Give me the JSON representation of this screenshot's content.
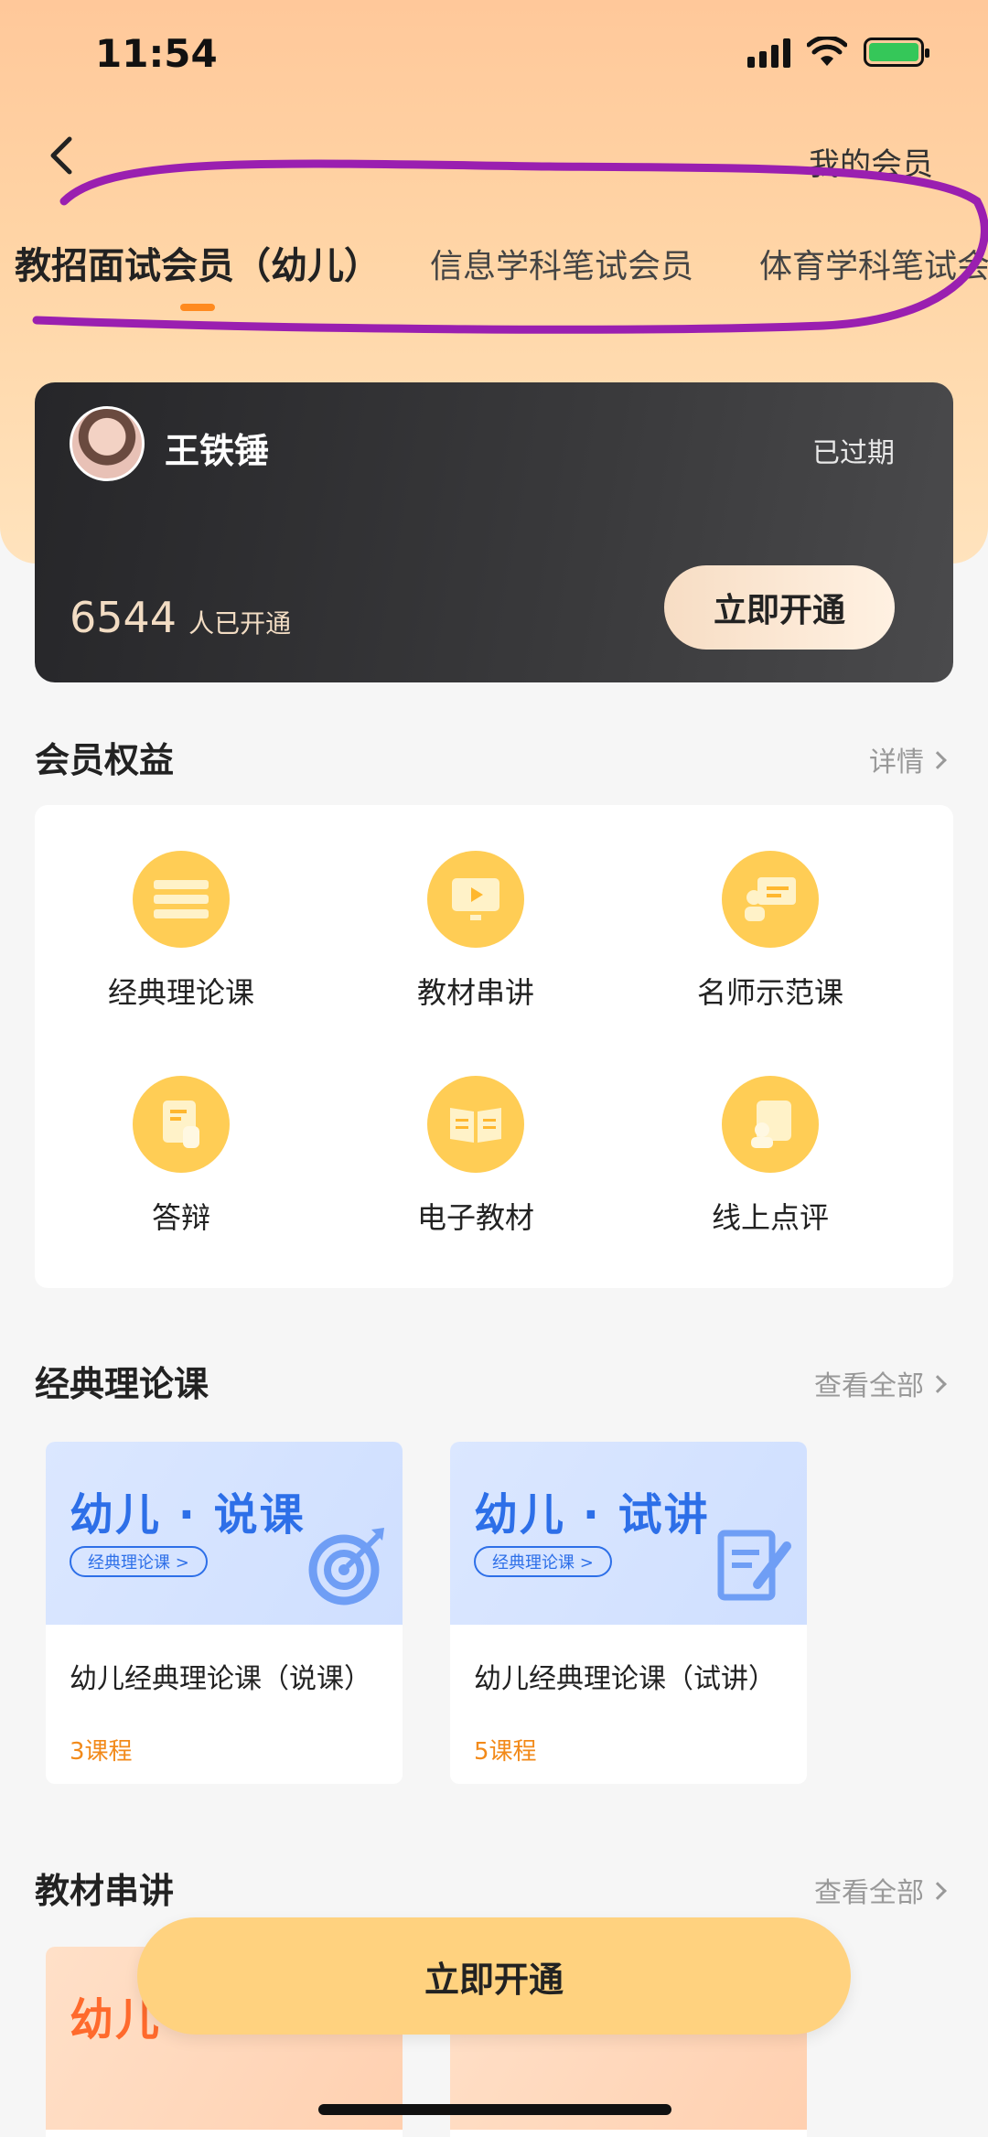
{
  "status_bar": {
    "time": "11:54"
  },
  "nav": {
    "my_member": "我的会员"
  },
  "tabs": [
    {
      "label": "教招面试会员（幼儿）",
      "active": true
    },
    {
      "label": "信息学科笔试会员",
      "active": false
    },
    {
      "label": "体育学科笔试会",
      "active": false
    }
  ],
  "member_card": {
    "username": "王铁锤",
    "status": "已过期",
    "count": "6544",
    "count_label": "人已开通",
    "open_button": "立即开通"
  },
  "benefits": {
    "title": "会员权益",
    "more": "详情",
    "items": [
      {
        "label": "经典理论课",
        "icon": "book-stack-icon"
      },
      {
        "label": "教材串讲",
        "icon": "video-screen-icon"
      },
      {
        "label": "名师示范课",
        "icon": "teacher-board-icon"
      },
      {
        "label": "答辩",
        "icon": "document-hand-icon"
      },
      {
        "label": "电子教材",
        "icon": "open-book-icon"
      },
      {
        "label": "线上点评",
        "icon": "review-card-icon"
      }
    ]
  },
  "classic": {
    "title": "经典理论课",
    "more": "查看全部",
    "courses": [
      {
        "banner_title": "幼儿 · 说课",
        "banner_tag": "经典理论课 >",
        "title": "幼儿经典理论课（说课）",
        "count": "3课程"
      },
      {
        "banner_title": "幼儿 · 试讲",
        "banner_tag": "经典理论课 >",
        "title": "幼儿经典理论课（试讲）",
        "count": "5课程"
      }
    ]
  },
  "textbook": {
    "title": "教材串讲",
    "more": "查看全部",
    "peek_banner_title": "幼儿"
  },
  "bottom_button": "立即开通",
  "colors": {
    "accent": "#ff8a1f",
    "button": "#ffd27f",
    "link_blue": "#2d6fe8",
    "count_orange": "#f28a1a"
  }
}
